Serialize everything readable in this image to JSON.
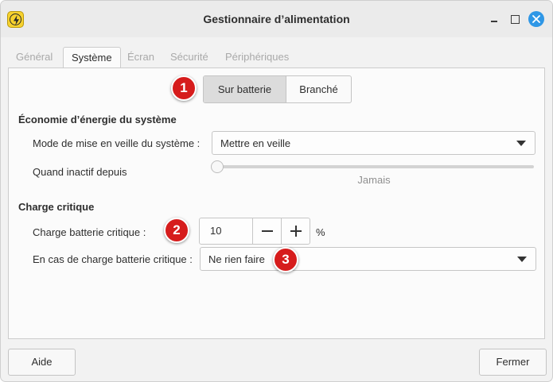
{
  "window": {
    "title": "Gestionnaire d’alimentation",
    "app_icon": "power-manager-icon",
    "controls": [
      "minimize-icon",
      "maximize-icon",
      "close-icon"
    ]
  },
  "tabs": [
    {
      "label": "Général",
      "active": false
    },
    {
      "label": "Système",
      "active": true
    },
    {
      "label": "Écran",
      "active": false
    },
    {
      "label": "Sécurité",
      "active": false
    },
    {
      "label": "Périphériques",
      "active": false
    }
  ],
  "power_mode": {
    "options": [
      "Sur batterie",
      "Branché"
    ],
    "selected": "Sur batterie"
  },
  "system_saving": {
    "heading": "Économie d’énergie du système",
    "sleep_mode_label": "Mode de mise en veille du système :",
    "sleep_mode_value": "Mettre en veille",
    "inactive_label": "Quand inactif depuis",
    "inactive_value_text": "Jamais",
    "inactive_slider_fraction": 0
  },
  "critical_charge": {
    "heading": "Charge critique",
    "level_label": "Charge batterie critique :",
    "level_value": "10",
    "level_unit": "%",
    "action_label": "En cas de charge batterie critique :",
    "action_value": "Ne rien faire"
  },
  "annotations": [
    "1",
    "2",
    "3"
  ],
  "footer": {
    "help_label": "Aide",
    "close_label": "Fermer"
  },
  "colors": {
    "badge": "#d61c1c",
    "close_button": "#2f97e6",
    "app_icon": "#f7d22e"
  }
}
